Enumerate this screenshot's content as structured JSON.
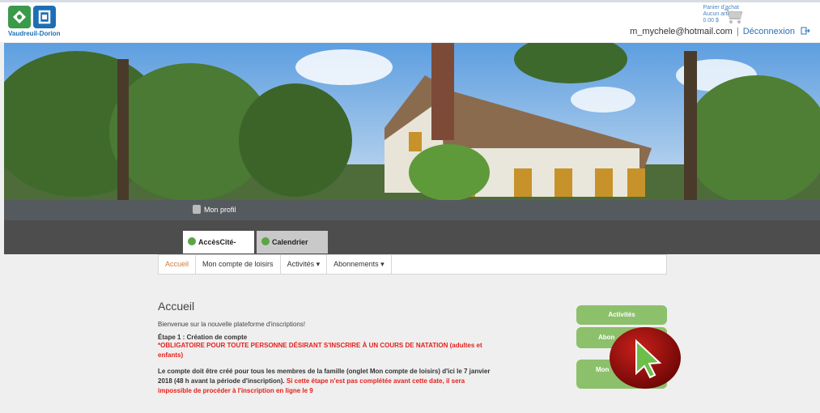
{
  "header": {
    "logo_text": "Vaudreuil-Dorion",
    "cart": {
      "title": "Panier d'achat",
      "items": "Aucun article",
      "total": "0.00 $"
    },
    "user_email": "m_mychele@hotmail.com",
    "separator": "|",
    "logout_label": "Déconnexion"
  },
  "profile_bar": {
    "label": "Mon profil"
  },
  "tabs": [
    {
      "label": "AccèsCité-Loisirs"
    },
    {
      "label": "Calendrier"
    }
  ],
  "subnav": {
    "items": [
      {
        "label": "Accueil"
      },
      {
        "label": "Mon compte de loisirs"
      },
      {
        "label": "Activités ▾"
      },
      {
        "label": "Abonnements ▾"
      }
    ]
  },
  "main": {
    "title": "Accueil",
    "intro": "Bienvenue sur la nouvelle plateforme d'inscriptions!",
    "step1": "Étape 1 : Création de compte",
    "mandatory": "*OBLIGATOIRE POUR TOUTE PERSONNE DÉSIRANT S'INSCRIRE À UN COURS DE NATATION (adultes et enfants)",
    "para_black": "Le compte doit être créé pour tous les membres de la famille (onglet Mon compte de loisirs) d'ici le 7 janvier 2018 (48 h avant la période d'inscription).",
    "para_red": "Si cette étape n'est pas complétée avant cette date, il sera impossible de procéder à l'inscription en ligne le 9"
  },
  "side_buttons": [
    {
      "label": "Activités"
    },
    {
      "label": "Abon"
    },
    {
      "label": "Mon"
    }
  ],
  "colors": {
    "accent_green": "#8cc06b",
    "link_blue": "#2a72b5",
    "alert_red": "#e2211c",
    "active_orange": "#d07a3a"
  }
}
